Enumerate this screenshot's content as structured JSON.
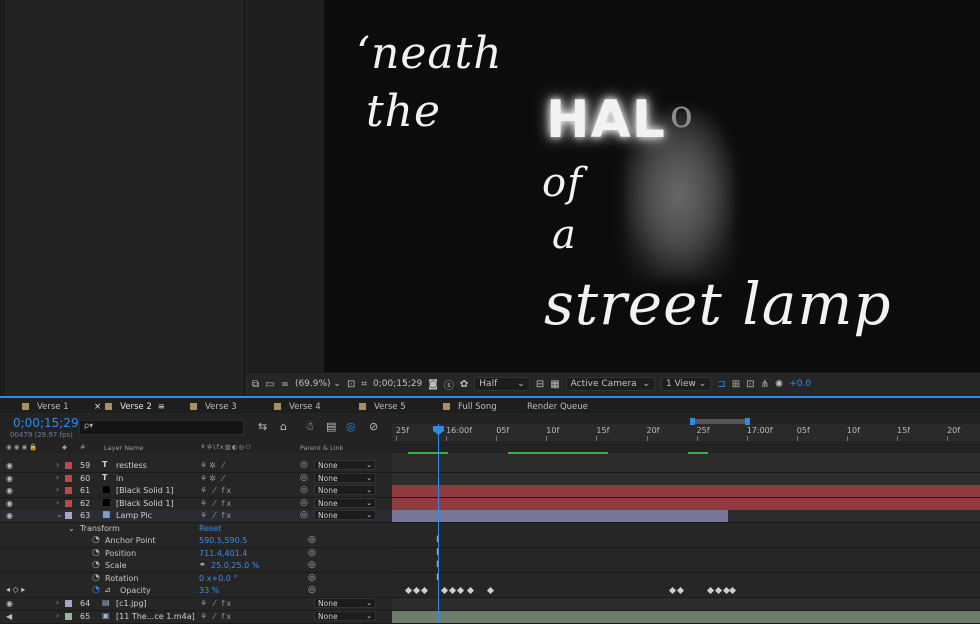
{
  "viewer": {
    "zoom": "(69.9%)",
    "timecode": "0;00;15;29",
    "resolution": "Half",
    "camera": "Active Camera",
    "views": "1 View",
    "exposure": "+0.0"
  },
  "comp_text": {
    "line1": "‘neath",
    "line2": "the",
    "line3_main": "HAL",
    "line3_o": "o",
    "line4": "of",
    "line5": "a",
    "line6": "street lamp"
  },
  "tabs": [
    {
      "label": "Verse 1"
    },
    {
      "label": "Verse 2",
      "active": true
    },
    {
      "label": "Verse 3"
    },
    {
      "label": "Verse 4"
    },
    {
      "label": "Verse 5"
    },
    {
      "label": "Full Song"
    },
    {
      "label": "Render Queue"
    }
  ],
  "timeline": {
    "timecode": "0;00;15;29",
    "fps": "00479 (29.97 fps)",
    "search_placeholder": "ρ▾",
    "ruler": [
      "25f",
      "16:00f",
      "05f",
      "10f",
      "15f",
      "20f",
      "25f",
      "17:00f",
      "05f",
      "10f",
      "15f",
      "20f"
    ],
    "col_layer_name": "Layer Name",
    "col_parent": "Parent & Link",
    "col_hash": "#"
  },
  "layers": [
    {
      "num": "59",
      "type": "T",
      "name": "restless",
      "color": "#b84a4a",
      "parent": "None"
    },
    {
      "num": "60",
      "type": "T",
      "name": "in",
      "color": "#b84a4a",
      "parent": "None"
    },
    {
      "num": "61",
      "type": "",
      "name": "[Black Solid 1]",
      "color": "#b84a4a",
      "parent": "None"
    },
    {
      "num": "62",
      "type": "",
      "name": "[Black Solid 1]",
      "color": "#b84a4a",
      "parent": "None"
    },
    {
      "num": "63",
      "type": "",
      "name": "Lamp Pic",
      "color": "#a6a3c7",
      "parent": "None"
    }
  ],
  "transform": {
    "label": "Transform",
    "reset": "Reset",
    "props": [
      {
        "name": "Anchor Point",
        "value": "590.5,590.5"
      },
      {
        "name": "Position",
        "value": "711.4,401.4"
      },
      {
        "name": "Scale",
        "value": "25.0,25.0 %"
      },
      {
        "name": "Rotation",
        "value": "0 x+0.0 °"
      },
      {
        "name": "Opacity",
        "value": "33 %"
      }
    ]
  },
  "bottom_layers": [
    {
      "num": "64",
      "name": "[c1.jpg]",
      "color": "#a6a3c7",
      "parent": "None"
    },
    {
      "num": "65",
      "name": "[11 The...ce 1.m4a]",
      "color": "#9bb59b",
      "parent": "None"
    }
  ],
  "colors": {
    "accent": "#2d8ceb",
    "red_layer": "#8f3b3f",
    "lavender_layer": "#78779a",
    "green_layer": "#6f7d6c"
  }
}
